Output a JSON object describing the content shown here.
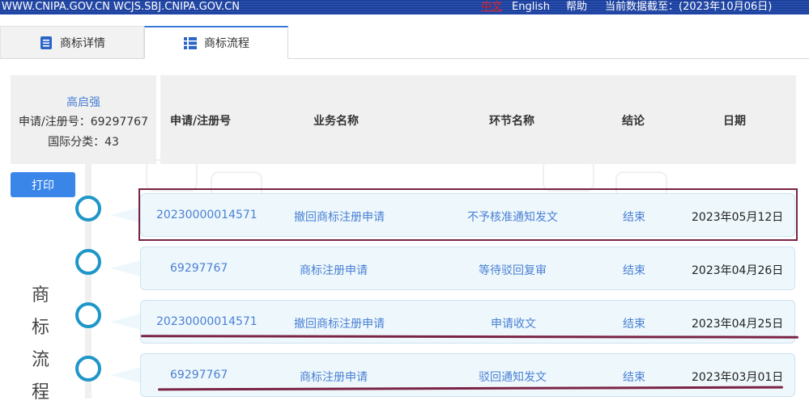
{
  "topbar": {
    "url": "WWW.CNIPA.GOV.CN WCJS.SBJ.CNIPA.GOV.CN",
    "lang_zh": "中文",
    "lang_en": "English",
    "help": "帮助",
    "data_date": "当前数据截至：(2023年10月06日)"
  },
  "tabs": [
    {
      "label": "商标详情",
      "icon": "document-icon"
    },
    {
      "label": "商标流程",
      "icon": "list-icon"
    }
  ],
  "info": {
    "name": "高启强",
    "reg_no": "申请/注册号：69297767",
    "class": "国际分类：43"
  },
  "table": {
    "headers": [
      "申请/注册号",
      "业务名称",
      "环节名称",
      "结论",
      "日期"
    ],
    "rows": [
      {
        "reg": "20230000014571",
        "business": "撤回商标注册申请",
        "step": "不予核准通知发文",
        "result": "结束",
        "date": "2023年05月12日"
      },
      {
        "reg": "69297767",
        "business": "商标注册申请",
        "step": "等待驳回复审",
        "result": "结束",
        "date": "2023年04月26日"
      },
      {
        "reg": "20230000014571",
        "business": "撤回商标注册申请",
        "step": "申请收文",
        "result": "结束",
        "date": "2023年04月25日"
      },
      {
        "reg": "69297767",
        "business": "商标注册申请",
        "step": "驳回通知发文",
        "result": "结束",
        "date": "2023年03月01日"
      }
    ]
  },
  "print_label": "打印",
  "side_title": [
    "商",
    "标",
    "流",
    "程"
  ],
  "colors": {
    "accent": "#3a86e8",
    "timeline": "#1f96c8",
    "highlight": "#7a2345",
    "link": "#4a7fd4"
  }
}
